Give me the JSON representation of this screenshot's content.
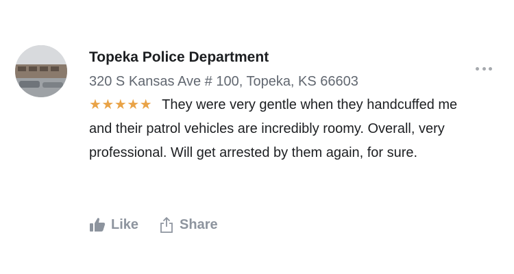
{
  "review": {
    "place_name": "Topeka Police Department",
    "address": "320 S Kansas Ave # 100, Topeka, KS 66603",
    "rating": 5,
    "rating_max": 5,
    "stars_text": "★★★★★",
    "text": "They were very gentle when they handcuffed me and their patrol vehicles are incredibly roomy. Overall, very professional. Will get arrested by them again, for sure."
  },
  "actions": {
    "like_label": "Like",
    "share_label": "Share"
  },
  "icons": {
    "avatar": "place-photo",
    "more": "more-options-icon",
    "like": "thumbs-up-icon",
    "share": "share-icon"
  },
  "colors": {
    "stars": "#e9a347",
    "secondary_text": "#616770",
    "action_text": "#8d949e"
  }
}
